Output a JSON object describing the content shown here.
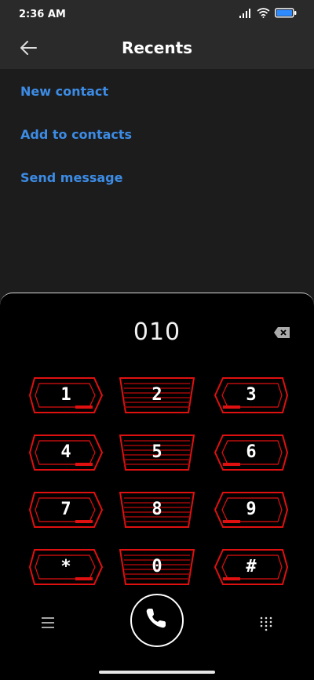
{
  "status": {
    "time": "2:36 AM",
    "battery_color": "#2e8bff"
  },
  "header": {
    "title": "Recents"
  },
  "actions": [
    "New contact",
    "Add to contacts",
    "Send message"
  ],
  "dialer": {
    "number": "010",
    "keys": [
      "1",
      "2",
      "3",
      "4",
      "5",
      "6",
      "7",
      "8",
      "9",
      "*",
      "0",
      "#"
    ],
    "accent": "#e01010"
  },
  "colors": {
    "link": "#3c8ce6",
    "background": "#1c1c1c"
  }
}
